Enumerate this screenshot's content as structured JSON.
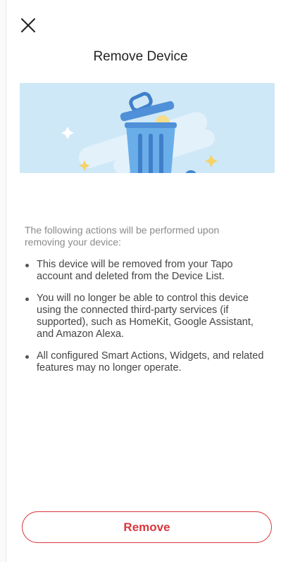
{
  "header": {
    "title": "Remove Device",
    "close_icon": "close-icon"
  },
  "hero": {
    "illustration": "trash-can-illustration"
  },
  "content": {
    "intro": "The following actions will be performed upon removing your device:",
    "bullets": [
      "This device will be removed from your Tapo account and deleted from the Device List.",
      "You will no longer be able to control this device using the connected third-party services (if supported), such as HomeKit, Google Assistant, and Amazon Alexa.",
      "All configured Smart Actions, Widgets, and related features may no longer operate."
    ]
  },
  "footer": {
    "remove_label": "Remove"
  },
  "colors": {
    "accent": "#d9383e",
    "hero_background": "#cfe8f7",
    "trash_blue": "#5ea3e2"
  }
}
